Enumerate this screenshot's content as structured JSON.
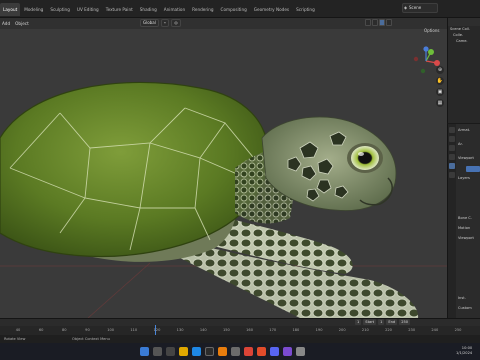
{
  "workspace_tabs": [
    "Layout",
    "Modeling",
    "Sculpting",
    "UV Editing",
    "Texture Paint",
    "Shading",
    "Animation",
    "Rendering",
    "Compositing",
    "Geometry Nodes",
    "Scripting"
  ],
  "active_tab_index": 0,
  "scene_label": "Scene",
  "viewport": {
    "menu": [
      "Add",
      "Object"
    ],
    "transform_orientation": "Global",
    "options_label": "Options"
  },
  "outliner": {
    "rows": [
      "Scene Coll.",
      "Colle.",
      "Came."
    ]
  },
  "properties": {
    "rows": [
      "Armat.",
      "Ar.",
      "Viewport",
      "Layers",
      "Bone C.",
      "Motion",
      "Viewport",
      "Inst.",
      "Custom"
    ]
  },
  "timeline": {
    "start_label": "Start",
    "start_value": "1",
    "end_label": "End",
    "end_value": "250",
    "current_frame": "1",
    "ticks": [
      "40",
      "60",
      "80",
      "90",
      "100",
      "110",
      "120",
      "130",
      "140",
      "150",
      "160",
      "170",
      "180",
      "190",
      "200",
      "210",
      "220",
      "230",
      "240",
      "250"
    ]
  },
  "statusbar": {
    "left": "Rotate View",
    "right": "Object Context Menu"
  },
  "tray": {
    "time": "10:00",
    "date": "1/1/2024"
  },
  "colors": {
    "accent": "#4772b3",
    "viewport_bg": "#3a3a3a",
    "shell_green": "#5f7d27",
    "skin_green": "#5a6b45"
  }
}
